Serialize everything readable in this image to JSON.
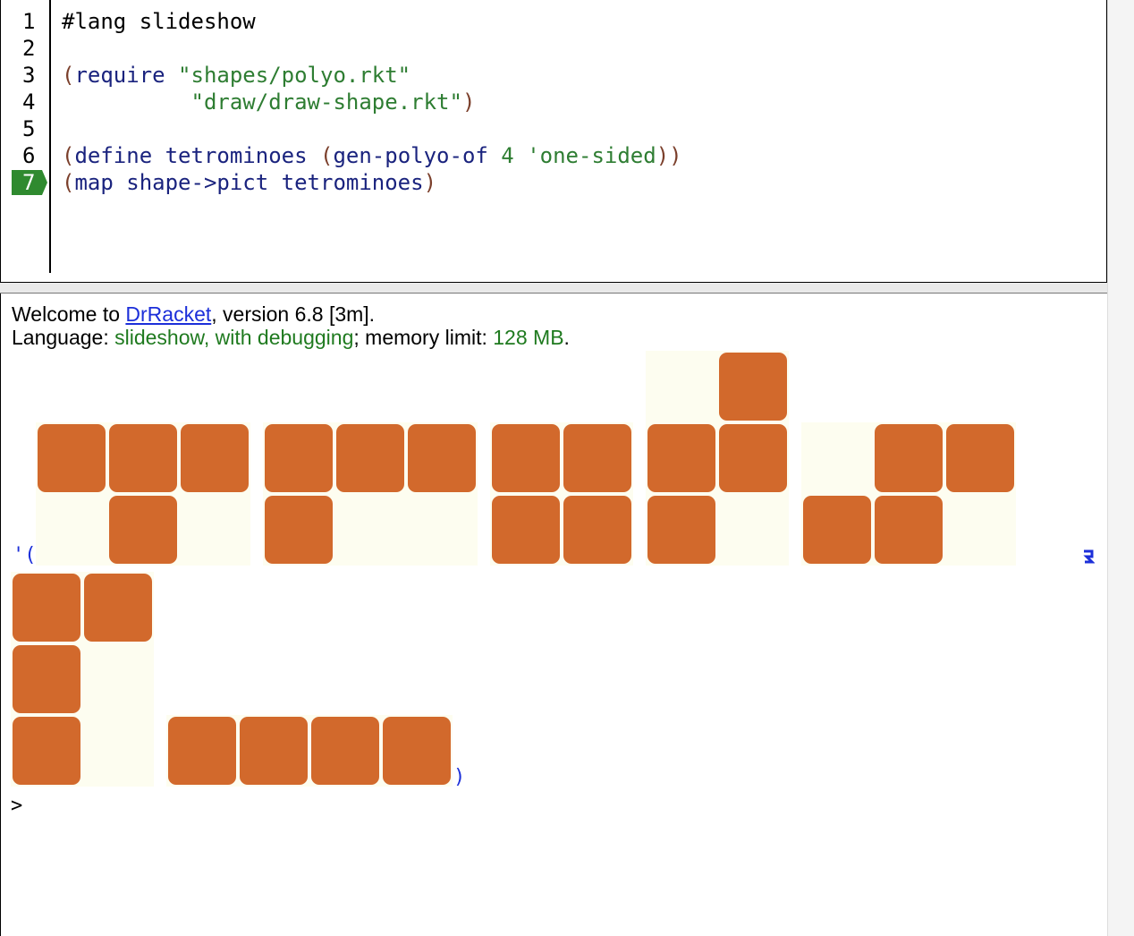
{
  "editor": {
    "line_numbers": [
      "1",
      "2",
      "3",
      "4",
      "5",
      "6",
      "7"
    ],
    "active_line": "7",
    "lines": [
      {
        "parts": [
          {
            "t": "#lang slideshow",
            "c": "plain"
          }
        ]
      },
      {
        "parts": []
      },
      {
        "parts": [
          {
            "t": "(",
            "c": "paren"
          },
          {
            "t": "require ",
            "c": "kw"
          },
          {
            "t": "\"shapes/polyo.rkt\"",
            "c": "str"
          }
        ]
      },
      {
        "parts": [
          {
            "t": "          ",
            "c": "plain"
          },
          {
            "t": "\"draw/draw-shape.rkt\"",
            "c": "str"
          },
          {
            "t": ")",
            "c": "paren"
          }
        ]
      },
      {
        "parts": []
      },
      {
        "parts": [
          {
            "t": "(",
            "c": "paren"
          },
          {
            "t": "define tetrominoes ",
            "c": "kw"
          },
          {
            "t": "(",
            "c": "paren"
          },
          {
            "t": "gen-polyo-of ",
            "c": "kw"
          },
          {
            "t": "4",
            "c": "num"
          },
          {
            "t": " ",
            "c": "kw"
          },
          {
            "t": "'one-sided",
            "c": "sym"
          },
          {
            "t": "))",
            "c": "paren"
          }
        ]
      },
      {
        "parts": [
          {
            "t": "(",
            "c": "paren"
          },
          {
            "t": "map shape->pict tetrominoes",
            "c": "kw"
          },
          {
            "t": ")",
            "c": "paren"
          }
        ]
      }
    ]
  },
  "repl": {
    "welcome_prefix": "Welcome to ",
    "welcome_link": "DrRacket",
    "welcome_suffix": ", version 6.8 [3m].",
    "language_label": "Language: ",
    "language_value": "slideshow, with debugging",
    "memory_label": "; memory limit: ",
    "memory_value": "128 MB",
    "memory_end": ".",
    "result_open": "'(",
    "result_close": ")",
    "prompt": ">"
  },
  "colors": {
    "block": "#d2692c",
    "block_background": "#fdfdf0",
    "active_line_marker": "#2f8a2f"
  }
}
